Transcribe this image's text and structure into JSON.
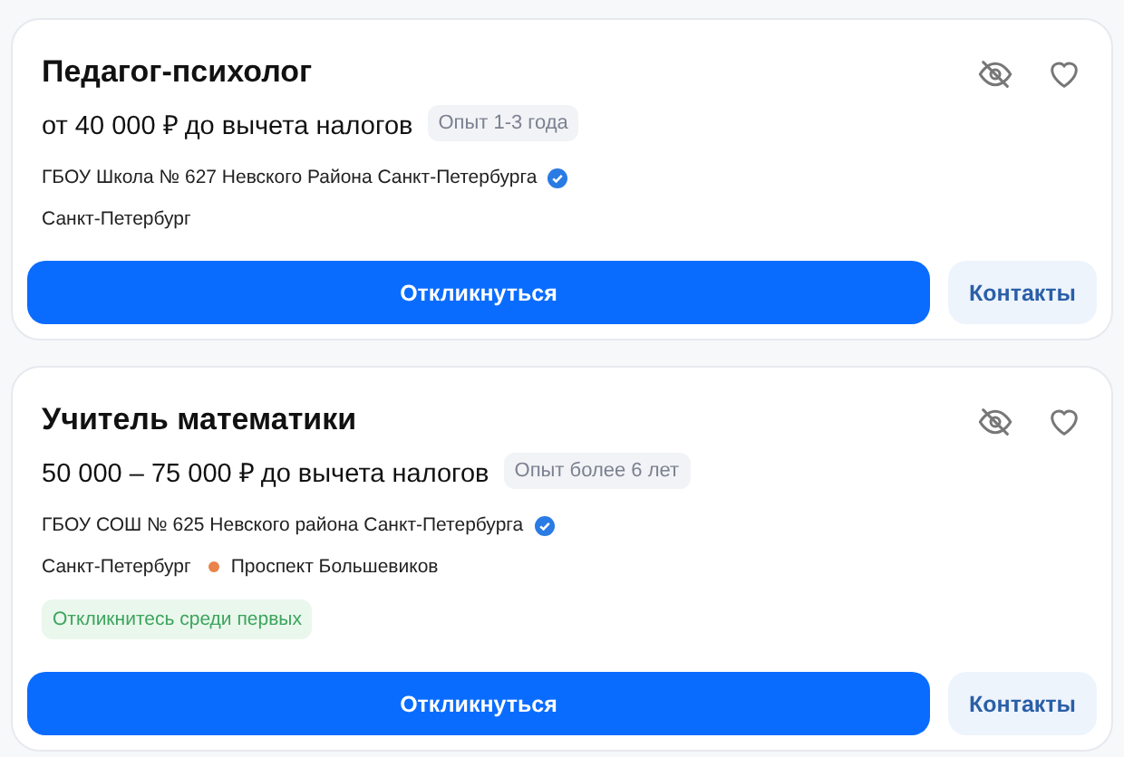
{
  "vacancies": [
    {
      "title": "Педагог-психолог",
      "salary": "от 40 000 ₽ до вычета налогов",
      "experience": "Опыт 1-3 года",
      "employer": "ГБОУ Школа № 627 Невского Района Санкт-Петербурга",
      "verified": true,
      "city": "Санкт-Петербург",
      "respond_button": "Откликнуться",
      "contacts_button": "Контакты"
    },
    {
      "title": "Учитель математики",
      "salary": "50 000 – 75 000 ₽ до вычета налогов",
      "experience": "Опыт более 6 лет",
      "employer": "ГБОУ СОШ № 625 Невского района Санкт-Петербурга",
      "verified": true,
      "city": "Санкт-Петербург",
      "metro": {
        "name": "Проспект Большевиков",
        "color": "#e8834a"
      },
      "badge": "Откликнитесь среди первых",
      "respond_button": "Откликнуться",
      "contacts_button": "Контакты"
    }
  ]
}
